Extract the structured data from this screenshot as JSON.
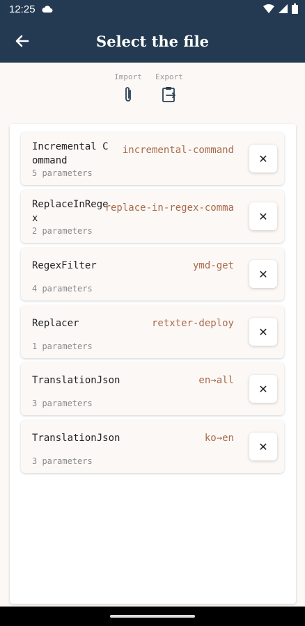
{
  "status": {
    "time": "12:25"
  },
  "appbar": {
    "title": "Select the file"
  },
  "actions": {
    "import_label": "Import",
    "export_label": "Export"
  },
  "items": [
    {
      "name": "Incremental Command",
      "command": "incremental-command",
      "params": "5 parameters"
    },
    {
      "name": "ReplaceInRegex",
      "command": "replace-in-regex-comma",
      "params": "2 parameters"
    },
    {
      "name": "RegexFilter",
      "command": "ymd-get",
      "params": "4 parameters"
    },
    {
      "name": "Replacer",
      "command": "retxter-deploy",
      "params": "1 parameters"
    },
    {
      "name": "TranslationJson",
      "command": "en→all",
      "params": "3 parameters"
    },
    {
      "name": "TranslationJson",
      "command": "ko→en",
      "params": "3 parameters"
    }
  ],
  "remove_label": "✕",
  "colors": {
    "appbar": "#233a52",
    "command": "#a86a4a",
    "background": "#fcf8f6"
  }
}
